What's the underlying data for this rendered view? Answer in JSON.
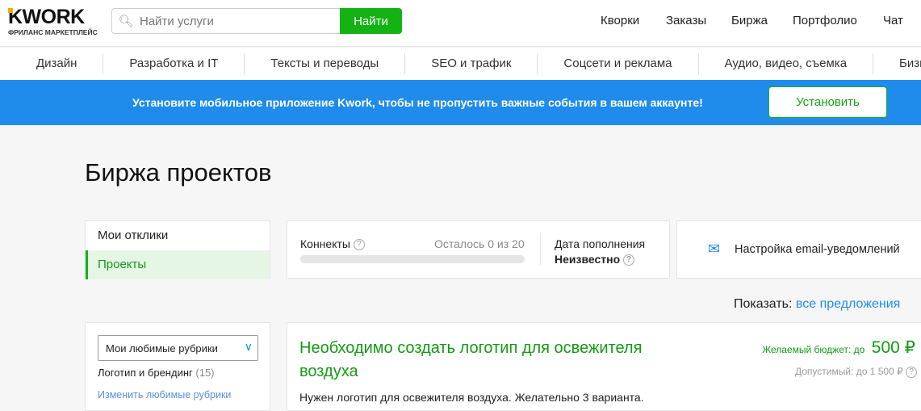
{
  "header": {
    "logo": "KWORK",
    "logo_sub": "ФРИЛАНС МАРКЕТПЛЕЙС",
    "search_placeholder": "Найти услуги",
    "search_button": "Найти",
    "nav": [
      "Кворки",
      "Заказы",
      "Биржа",
      "Портфолио",
      "Чат"
    ]
  },
  "categories": [
    "Дизайн",
    "Разработка и IT",
    "Тексты и переводы",
    "SEO и трафик",
    "Соцсети и реклама",
    "Аудио, видео, съемка",
    "Бизн"
  ],
  "banner": {
    "text": "Установите мобильное приложение Kwork, чтобы не пропустить важные события в вашем аккаунте!",
    "button": "Установить"
  },
  "page_title": "Биржа проектов",
  "tabs": [
    "Мои отклики",
    "Проекты"
  ],
  "connects": {
    "label": "Коннекты",
    "remaining": "Осталось 0 из 20",
    "progress": 0,
    "date_label": "Дата пополнения",
    "date_value": "Неизвестно"
  },
  "email_settings": "Настройка email-уведомлений",
  "show": {
    "label": "Показать:",
    "value": "все предложения"
  },
  "filter": {
    "select": "Мои любимые рубрики",
    "category": "Логотип и брендинг",
    "count": "(15)",
    "edit_link": "Изменить любимые рубрики"
  },
  "project": {
    "title": "Необходимо создать логотип для освежителя воздуха",
    "description": "Нужен логотип для освежителя воздуха. Желательно 3 варианта.",
    "budget_label": "Желаемый бюджет: до",
    "budget": "500 ₽",
    "allowed": "Допустимый: до 1 500 ₽"
  }
}
